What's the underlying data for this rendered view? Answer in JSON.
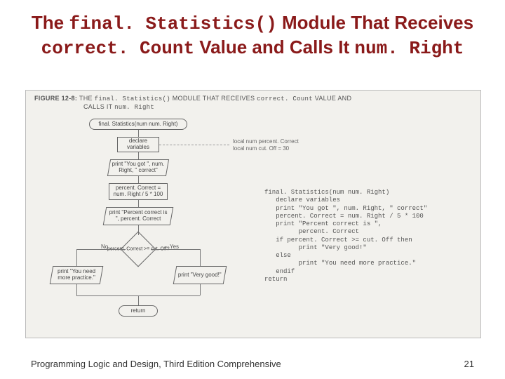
{
  "title": {
    "part1": "The ",
    "code1": "final. Statistics()",
    "part2": " Module That Receives ",
    "code2": "correct. Count",
    "part3": " Value and Calls It ",
    "code3": "num. Right"
  },
  "figure_caption": {
    "prefix": "FIGURE 12-8: ",
    "line1a": "THE ",
    "mono1": "final. Statistics()",
    "line1b": " MODULE THAT RECEIVES ",
    "mono2": "correct. Count",
    "line1c": " VALUE AND",
    "line2a": "CALLS IT ",
    "mono3": "num. Right"
  },
  "flow": {
    "start": "final. Statistics(num num. Right)",
    "declare": "declare variables",
    "sidenote": "local num percent. Correct\nlocal num cut. Off = 30",
    "print1": "print \"You got \", num. Right, \" correct\"",
    "calc": "percent. Correct = num. Right / 5 * 100",
    "print2": "print \"Percent correct is \", percent. Correct",
    "decision": "percent. Correct >= cut. Off?",
    "no_label": "No",
    "yes_label": "Yes",
    "print_no": "print \"You need more practice.\"",
    "print_yes": "print \"Very good!\"",
    "return": "return"
  },
  "pseudocode": "final. Statistics(num num. Right)\n   declare variables\n   print \"You got \", num. Right, \" correct\"\n   percent. Correct = num. Right / 5 * 100\n   print \"Percent correct is \",\n         percent. Correct\n   if percent. Correct >= cut. Off then\n         print \"Very good!\"\n   else\n         print \"You need more practice.\"\n   endif\nreturn",
  "footer": {
    "text": "Programming Logic and Design, Third Edition Comprehensive",
    "page": "21"
  }
}
